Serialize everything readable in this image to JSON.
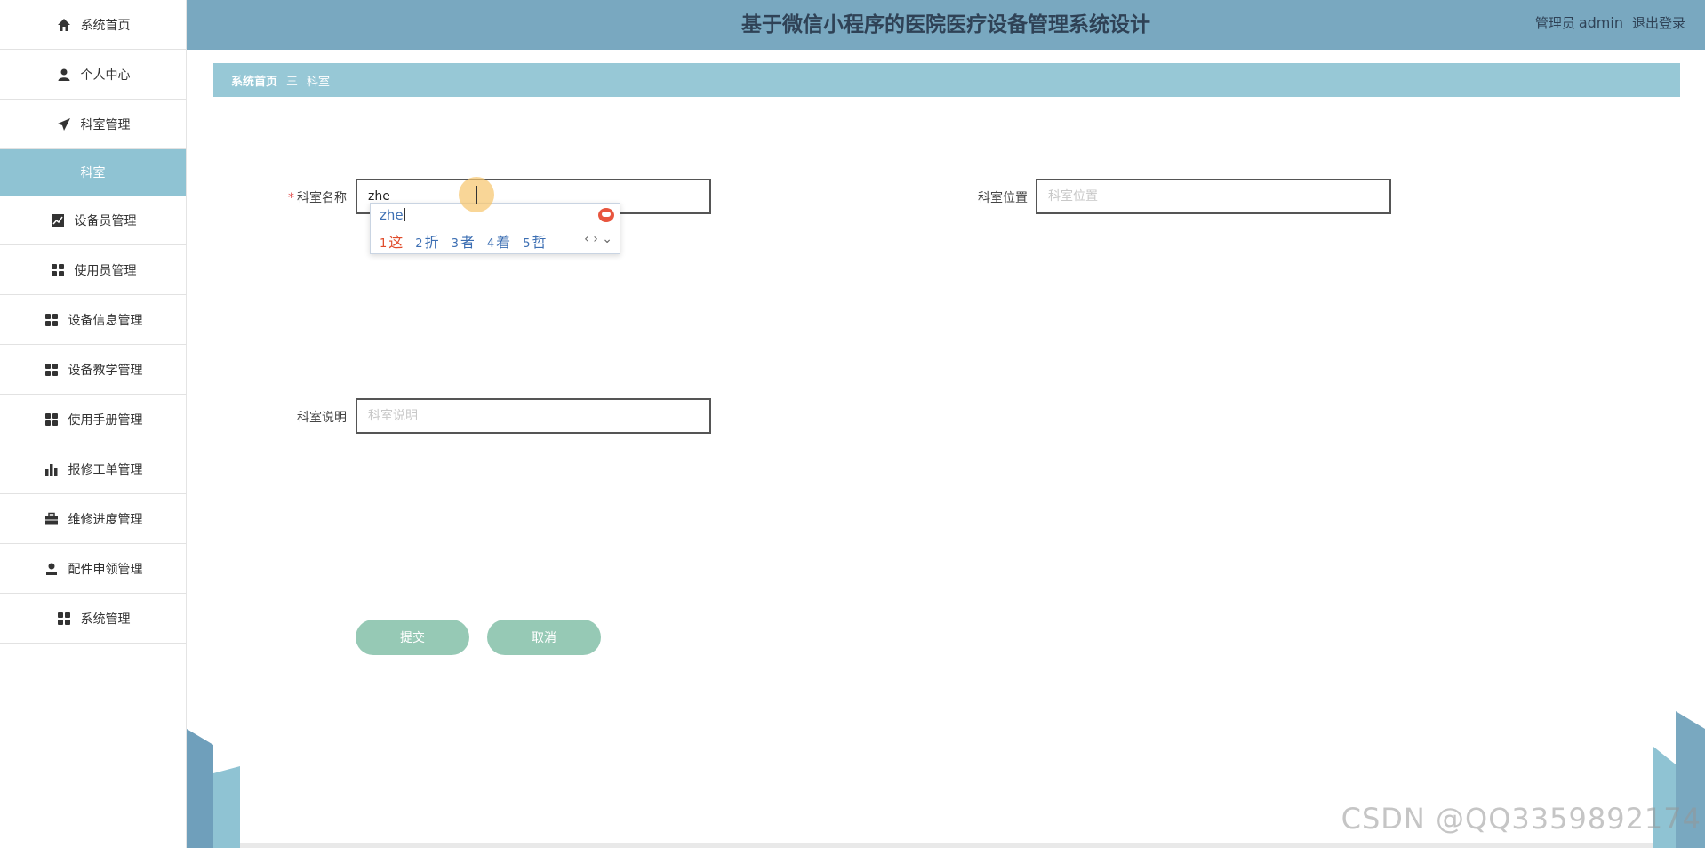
{
  "header": {
    "title": "基于微信小程序的医院医疗设备管理系统设计",
    "role": "管理员",
    "username": "admin",
    "logout": "退出登录"
  },
  "sidebar": {
    "items": [
      {
        "label": "系统首页",
        "icon": "home-icon"
      },
      {
        "label": "个人中心",
        "icon": "user-icon"
      },
      {
        "label": "科室管理",
        "icon": "send-icon"
      },
      {
        "label": "科室",
        "icon": "",
        "sub": true
      },
      {
        "label": "设备员管理",
        "icon": "chart-line-icon"
      },
      {
        "label": "使用员管理",
        "icon": "grid-icon"
      },
      {
        "label": "设备信息管理",
        "icon": "grid-icon"
      },
      {
        "label": "设备教学管理",
        "icon": "grid-icon"
      },
      {
        "label": "使用手册管理",
        "icon": "grid-icon"
      },
      {
        "label": "报修工单管理",
        "icon": "bar-chart-icon"
      },
      {
        "label": "维修进度管理",
        "icon": "briefcase-icon"
      },
      {
        "label": "配件申领管理",
        "icon": "person-icon"
      },
      {
        "label": "系统管理",
        "icon": "grid-icon"
      }
    ]
  },
  "breadcrumb": {
    "home": "系统首页",
    "separator": "三",
    "current": "科室"
  },
  "form": {
    "name_label": "科室名称",
    "name_required": "*",
    "name_value": "zhe",
    "location_label": "科室位置",
    "location_placeholder": "科室位置",
    "desc_label": "科室说明",
    "desc_placeholder": "科室说明",
    "submit": "提交",
    "cancel": "取消"
  },
  "ime": {
    "composition": "zhe",
    "candidates": [
      {
        "n": "1",
        "text": "这"
      },
      {
        "n": "2",
        "text": "折"
      },
      {
        "n": "3",
        "text": "者"
      },
      {
        "n": "4",
        "text": "着"
      },
      {
        "n": "5",
        "text": "哲"
      }
    ],
    "nav": "‹ › ⌄"
  },
  "watermark": "CSDN @QQ3359892174",
  "colors": {
    "header": "#79a8c0",
    "breadcrumb": "#97c8d6",
    "active_sidebar": "#8fc3d3",
    "button": "#96c9b5"
  }
}
